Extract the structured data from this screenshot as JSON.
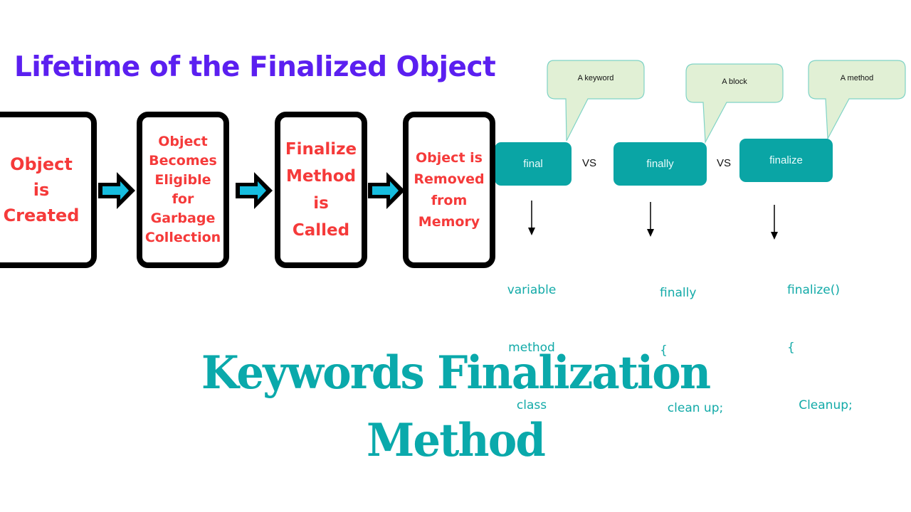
{
  "header": {
    "title": "Lifetime of the Finalized Object"
  },
  "lifecycle": {
    "stages": [
      {
        "lines": [
          "Object",
          "is",
          "Created"
        ]
      },
      {
        "lines": [
          "Object",
          "Becomes",
          "Eligible",
          "for",
          "Garbage",
          "Collection"
        ]
      },
      {
        "lines": [
          "Finalize",
          "Method",
          "is",
          "Called"
        ]
      },
      {
        "lines": [
          "Object is",
          "Removed",
          "from",
          "Memory"
        ]
      }
    ],
    "arrow_icon": "right-arrow-icon",
    "colors": {
      "text": "#f53a3a",
      "border": "#000000",
      "arrow_fill": "#16bddf"
    }
  },
  "comparison": {
    "vs_label": "VS",
    "keywords": [
      {
        "label": "final",
        "callout": "A keyword",
        "usage": [
          "variable",
          "method",
          "class"
        ]
      },
      {
        "label": "finally",
        "callout": "A block",
        "usage": [
          "finally",
          "{",
          "  clean up;"
        ]
      },
      {
        "label": "finalize",
        "callout": "A method",
        "usage": [
          "finalize()",
          "{",
          "   Cleanup;"
        ]
      }
    ],
    "colors": {
      "box": "#0aa5a5",
      "callout_fill": "#e1f0d5",
      "callout_border": "#7fd3c6",
      "usage_text": "#12aaa8"
    }
  },
  "footer": {
    "title_line1": "Keywords Finalization",
    "title_line2": "Method",
    "color": "#0aa9ab"
  }
}
